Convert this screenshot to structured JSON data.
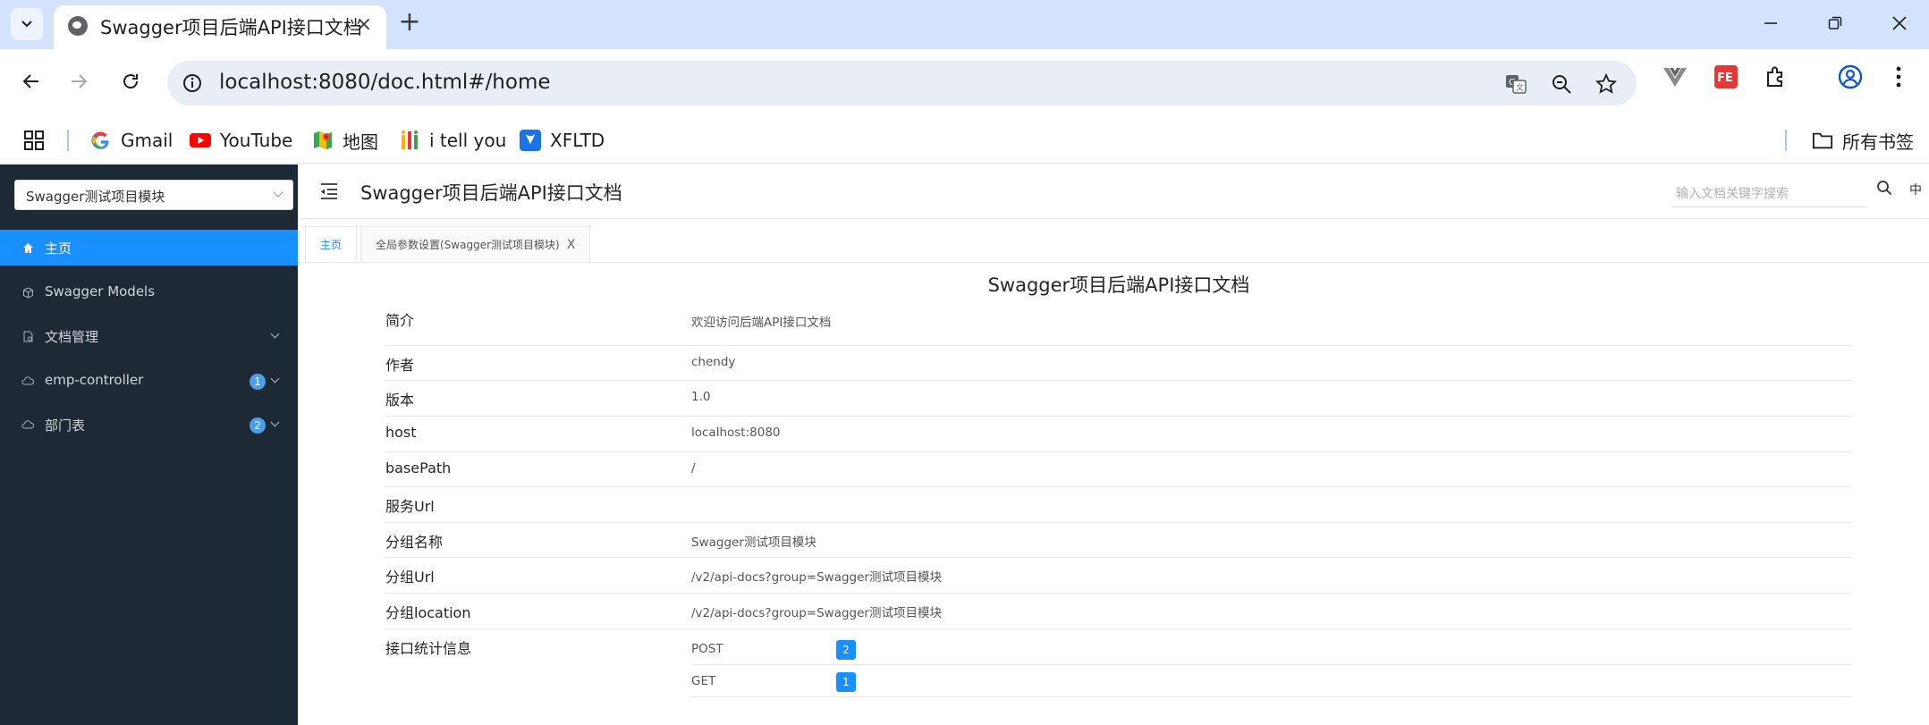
{
  "browser": {
    "tab_title": "Swagger项目后端API接口文档",
    "new_tab": "+",
    "tab_close": "×",
    "url": "localhost:8080/doc.html#/home",
    "bookmarks": [
      {
        "label": "Gmail",
        "icon": "google-icon"
      },
      {
        "label": "YouTube",
        "icon": "youtube-icon"
      },
      {
        "label": "地图",
        "icon": "maps-icon"
      },
      {
        "label": "i tell you",
        "icon": "itellyou-icon"
      },
      {
        "label": "XFLTD",
        "icon": "xfltd-icon"
      }
    ],
    "all_bookmarks": "所有书签"
  },
  "sidebar": {
    "group_select": "Swagger测试项目模块",
    "items": [
      {
        "label": "主页",
        "icon": "home-icon",
        "active": true
      },
      {
        "label": "Swagger Models",
        "icon": "cube-icon"
      },
      {
        "label": "文档管理",
        "icon": "doc-manage-icon"
      },
      {
        "label": "emp-controller",
        "icon": "cloud-icon",
        "badge": "1"
      },
      {
        "label": "部门表",
        "icon": "cloud-icon",
        "badge": "2"
      }
    ]
  },
  "header": {
    "title": "Swagger项目后端API接口文档",
    "search_placeholder": "输入文档关键字搜索",
    "lang": "中"
  },
  "page_tabs": [
    {
      "label": "主页",
      "active": true
    },
    {
      "label": "全局参数设置(Swagger测试项目模块)",
      "closable": true,
      "close": "X"
    }
  ],
  "doc": {
    "title": "Swagger项目后端API接口文档",
    "rows": [
      {
        "key": "简介",
        "value": "欢迎访问后端API接口文档"
      },
      {
        "key": "作者",
        "value": "chendy"
      },
      {
        "key": "版本",
        "value": "1.0"
      },
      {
        "key": "host",
        "value": "localhost:8080"
      },
      {
        "key": "basePath",
        "value": "/"
      },
      {
        "key": "服务Url",
        "value": ""
      },
      {
        "key": "分组名称",
        "value": "Swagger测试项目模块"
      },
      {
        "key": "分组Url",
        "value": "/v2/api-docs?group=Swagger测试项目模块"
      },
      {
        "key": "分组location",
        "value": "/v2/api-docs?group=Swagger测试项目模块"
      }
    ],
    "stats_label": "接口统计信息",
    "stats": [
      {
        "method": "POST",
        "count": "2"
      },
      {
        "method": "GET",
        "count": "1"
      }
    ]
  },
  "colors": {
    "accent": "#1890ff",
    "sidebar_bg": "#1d2a35",
    "tabstrip_bg": "#d3e3fd",
    "badge": "#4b9eea"
  }
}
